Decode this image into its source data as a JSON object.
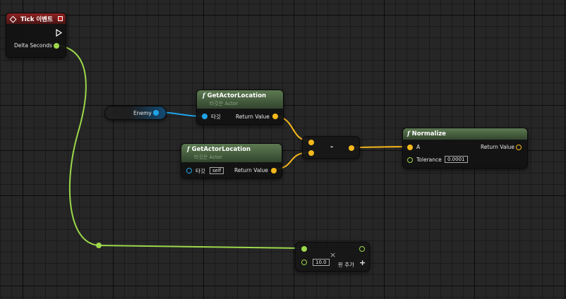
{
  "graph": {
    "nodes": {
      "tick_event": {
        "title": "Tick 이벤트",
        "output_label": "Delta Seconds"
      },
      "enemy_var": {
        "label": "Enemy"
      },
      "get_actor_location_1": {
        "title": "GetActorLocation",
        "subtitle": "타깃은 Actor",
        "target_label": "타깃",
        "return_label": "Return Value"
      },
      "get_actor_location_2": {
        "title": "GetActorLocation",
        "subtitle": "타깃은 Actor",
        "target_label": "타깃",
        "target_value": "self",
        "return_label": "Return Value"
      },
      "subtract": {
        "operator": "-"
      },
      "normalize": {
        "title": "Normalize",
        "input_label": "A",
        "return_label": "Return Value",
        "tolerance_label": "Tolerance",
        "tolerance_value": "0.0001"
      },
      "multiply": {
        "operator": "×",
        "input_value": "10.0",
        "add_pin_label": "핀 추가",
        "add_pin_icon": "+"
      }
    },
    "colors": {
      "float_pin": "#9cd84a",
      "vector_pin": "#f5b81c",
      "object_pin": "#1fa3e8",
      "exec_pin": "#ffffff",
      "event_header": "#8e2020",
      "function_header": "#5d7a52"
    }
  }
}
